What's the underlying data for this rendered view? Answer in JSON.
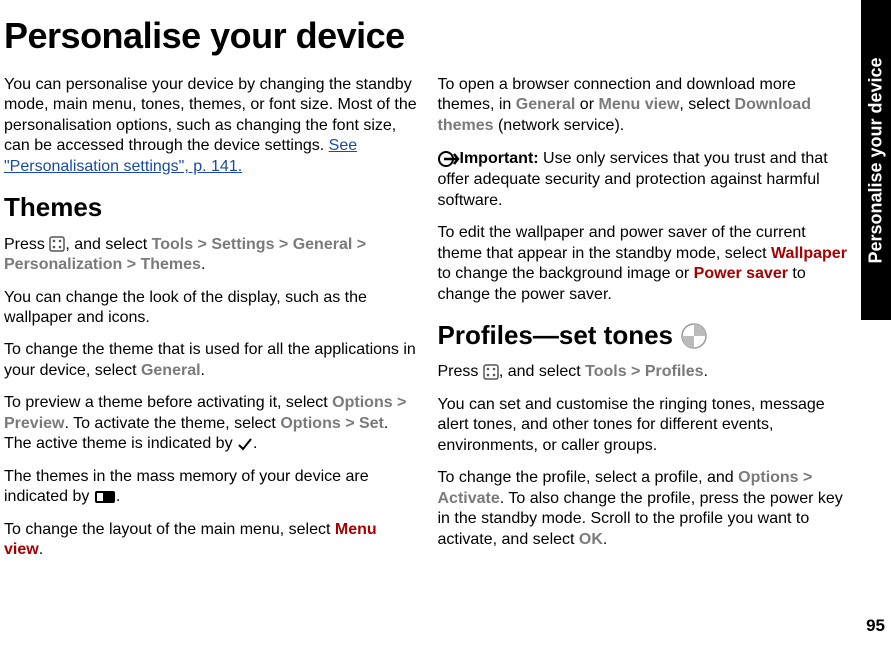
{
  "sidebar_label": "Personalise your device",
  "page_number": "95",
  "title": "Personalise your device",
  "intro_1": "You can personalise your device by changing the standby mode, main menu, tones, themes, or font size. Most of the personalisation options, such as changing the font size, can be accessed through the device settings. ",
  "link_personalisation": "See \"Personalisation settings\", p. 141.",
  "h_themes": "Themes",
  "press": "Press ",
  "and_select": ", and select ",
  "sep": " > ",
  "tools": "Tools",
  "settings": "Settings",
  "general": "General",
  "personalization": "Personalization",
  "themes": "Themes",
  "themes_p1": "You can change the look of the display, such as the wallpaper and icons.",
  "themes_p2a": "To change the theme that is used for all the applications in your device, select ",
  "themes_p3a": "To preview a theme before activating it, select ",
  "options": "Options",
  "preview": "Preview",
  "themes_p3b": ". To activate the theme, select ",
  "set": "Set",
  "themes_p3c": ". The active theme is indicated by ",
  "themes_p4a": "The themes in the mass memory of your device are indicated by ",
  "menu_view_p": "To change the layout of the main menu, select ",
  "menu_view": "Menu view",
  "col2_p1a": "To open a browser connection and download more themes, in ",
  "or": " or ",
  "col2_p1b": ", select ",
  "download_themes": "Download themes",
  "network_service": " (network service).",
  "important": "Important:  ",
  "important_body": "Use only services that you trust and that offer adequate security and protection against harmful software.",
  "col2_p3a": "To edit the wallpaper and power saver of the current theme that appear in the standby mode, select ",
  "wallpaper": "Wallpaper",
  "col2_p3b": " to change the background image or ",
  "power_saver": "Power saver",
  "col2_p3c": " to change the power saver.",
  "h_profiles": "Profiles—set tones",
  "profiles": "Profiles",
  "profiles_p1": "You can set and customise the ringing tones, message alert tones, and other tones for different events, environments, or caller groups.",
  "profiles_p2a": "To change the profile, select a profile, and ",
  "activate": "Activate",
  "profiles_p2b": ". To also change the profile, press the power key in the standby mode. Scroll to the profile you want to activate, and select ",
  "ok": "OK",
  "dot": "."
}
